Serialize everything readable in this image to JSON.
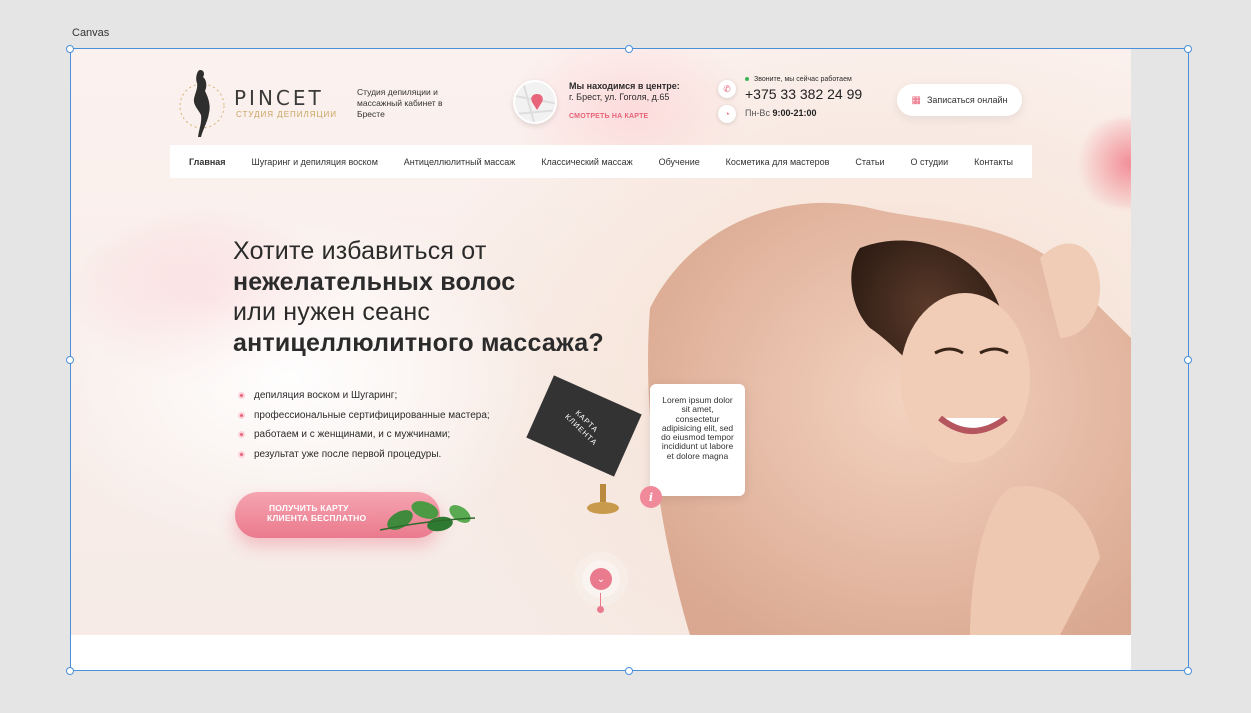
{
  "editor": {
    "canvas_label": "Canvas"
  },
  "header": {
    "logo_name": "PINCET",
    "logo_sub": "СТУДИЯ ДЕПИЛЯЦИИ",
    "tagline": "Студия депиляции и массажный кабинет в Бресте",
    "address_title": "Мы находимся в центре:",
    "address_line": "г. Брест, ул. Гоголя, д.65",
    "map_link": "СМОТРЕТЬ НА КАРТЕ",
    "phone_status": "Звоните, мы сейчас работаем",
    "phone_number": "+375 33 382 24 99",
    "hours_label": "Пн-Вс",
    "hours_value": "9:00-21:00",
    "book_button": "Записаться онлайн"
  },
  "nav": {
    "items": [
      {
        "label": "Главная"
      },
      {
        "label": "Шугаринг и депиляция воском"
      },
      {
        "label": "Антицеллюлитный массаж"
      },
      {
        "label": "Классический массаж"
      },
      {
        "label": "Обучение"
      },
      {
        "label": "Косметика для мастеров"
      },
      {
        "label": "Статьи"
      },
      {
        "label": "О студии"
      },
      {
        "label": "Контакты"
      }
    ]
  },
  "hero": {
    "line1": "Хотите избавиться от",
    "line2": "нежелательных волос",
    "line3": "или нужен сеанс",
    "line4": "антицеллюлитного массажа?",
    "bullets": [
      "депиляция воском и Шугаринг;",
      "профессиональные сертифицированные мастера;",
      "работаем и с женщинами, и с мужчинами;",
      "результат уже после первой процедуры."
    ],
    "cta_line1": "ПОЛУЧИТЬ КАРТУ",
    "cta_line2": "КЛИЕНТА БЕСПЛАТНО",
    "card_line1": "КАРТА",
    "card_line2": "КЛИЕНТА",
    "tooltip_text": "Lorem ipsum dolor sit amet, consectetur adipisicing elit, sed do eiusmod tempor incididunt ut labore et dolore magna",
    "info_icon": "i",
    "scroll_icon": "chevron-down-icon"
  },
  "colors": {
    "accent": "#e8647a",
    "selection": "#4a90d9",
    "gold": "#c9a45f"
  }
}
